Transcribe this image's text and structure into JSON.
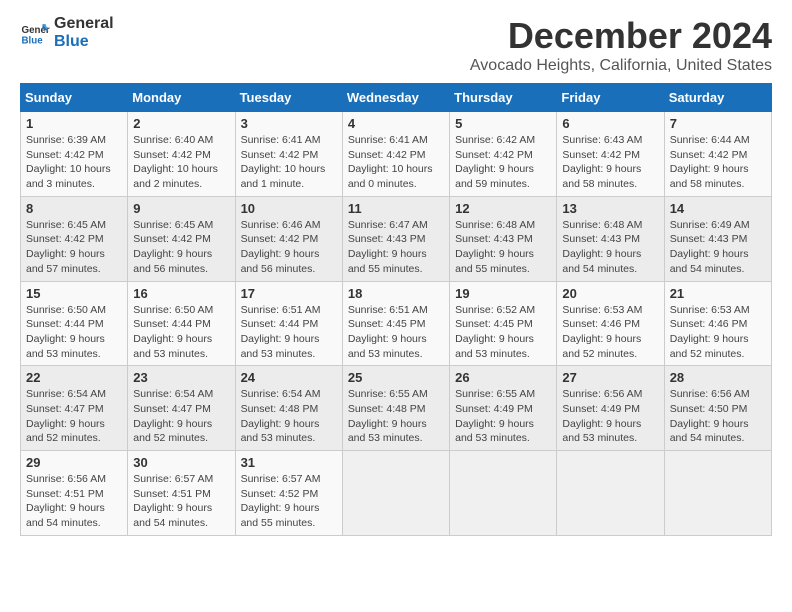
{
  "logo": {
    "line1": "General",
    "line2": "Blue"
  },
  "title": "December 2024",
  "subtitle": "Avocado Heights, California, United States",
  "headers": [
    "Sunday",
    "Monday",
    "Tuesday",
    "Wednesday",
    "Thursday",
    "Friday",
    "Saturday"
  ],
  "weeks": [
    [
      {
        "day": "1",
        "sunrise": "6:39 AM",
        "sunset": "4:42 PM",
        "daylight": "10 hours and 3 minutes."
      },
      {
        "day": "2",
        "sunrise": "6:40 AM",
        "sunset": "4:42 PM",
        "daylight": "10 hours and 2 minutes."
      },
      {
        "day": "3",
        "sunrise": "6:41 AM",
        "sunset": "4:42 PM",
        "daylight": "10 hours and 1 minute."
      },
      {
        "day": "4",
        "sunrise": "6:41 AM",
        "sunset": "4:42 PM",
        "daylight": "10 hours and 0 minutes."
      },
      {
        "day": "5",
        "sunrise": "6:42 AM",
        "sunset": "4:42 PM",
        "daylight": "9 hours and 59 minutes."
      },
      {
        "day": "6",
        "sunrise": "6:43 AM",
        "sunset": "4:42 PM",
        "daylight": "9 hours and 58 minutes."
      },
      {
        "day": "7",
        "sunrise": "6:44 AM",
        "sunset": "4:42 PM",
        "daylight": "9 hours and 58 minutes."
      }
    ],
    [
      {
        "day": "8",
        "sunrise": "6:45 AM",
        "sunset": "4:42 PM",
        "daylight": "9 hours and 57 minutes."
      },
      {
        "day": "9",
        "sunrise": "6:45 AM",
        "sunset": "4:42 PM",
        "daylight": "9 hours and 56 minutes."
      },
      {
        "day": "10",
        "sunrise": "6:46 AM",
        "sunset": "4:42 PM",
        "daylight": "9 hours and 56 minutes."
      },
      {
        "day": "11",
        "sunrise": "6:47 AM",
        "sunset": "4:43 PM",
        "daylight": "9 hours and 55 minutes."
      },
      {
        "day": "12",
        "sunrise": "6:48 AM",
        "sunset": "4:43 PM",
        "daylight": "9 hours and 55 minutes."
      },
      {
        "day": "13",
        "sunrise": "6:48 AM",
        "sunset": "4:43 PM",
        "daylight": "9 hours and 54 minutes."
      },
      {
        "day": "14",
        "sunrise": "6:49 AM",
        "sunset": "4:43 PM",
        "daylight": "9 hours and 54 minutes."
      }
    ],
    [
      {
        "day": "15",
        "sunrise": "6:50 AM",
        "sunset": "4:44 PM",
        "daylight": "9 hours and 53 minutes."
      },
      {
        "day": "16",
        "sunrise": "6:50 AM",
        "sunset": "4:44 PM",
        "daylight": "9 hours and 53 minutes."
      },
      {
        "day": "17",
        "sunrise": "6:51 AM",
        "sunset": "4:44 PM",
        "daylight": "9 hours and 53 minutes."
      },
      {
        "day": "18",
        "sunrise": "6:51 AM",
        "sunset": "4:45 PM",
        "daylight": "9 hours and 53 minutes."
      },
      {
        "day": "19",
        "sunrise": "6:52 AM",
        "sunset": "4:45 PM",
        "daylight": "9 hours and 53 minutes."
      },
      {
        "day": "20",
        "sunrise": "6:53 AM",
        "sunset": "4:46 PM",
        "daylight": "9 hours and 52 minutes."
      },
      {
        "day": "21",
        "sunrise": "6:53 AM",
        "sunset": "4:46 PM",
        "daylight": "9 hours and 52 minutes."
      }
    ],
    [
      {
        "day": "22",
        "sunrise": "6:54 AM",
        "sunset": "4:47 PM",
        "daylight": "9 hours and 52 minutes."
      },
      {
        "day": "23",
        "sunrise": "6:54 AM",
        "sunset": "4:47 PM",
        "daylight": "9 hours and 52 minutes."
      },
      {
        "day": "24",
        "sunrise": "6:54 AM",
        "sunset": "4:48 PM",
        "daylight": "9 hours and 53 minutes."
      },
      {
        "day": "25",
        "sunrise": "6:55 AM",
        "sunset": "4:48 PM",
        "daylight": "9 hours and 53 minutes."
      },
      {
        "day": "26",
        "sunrise": "6:55 AM",
        "sunset": "4:49 PM",
        "daylight": "9 hours and 53 minutes."
      },
      {
        "day": "27",
        "sunrise": "6:56 AM",
        "sunset": "4:49 PM",
        "daylight": "9 hours and 53 minutes."
      },
      {
        "day": "28",
        "sunrise": "6:56 AM",
        "sunset": "4:50 PM",
        "daylight": "9 hours and 54 minutes."
      }
    ],
    [
      {
        "day": "29",
        "sunrise": "6:56 AM",
        "sunset": "4:51 PM",
        "daylight": "9 hours and 54 minutes."
      },
      {
        "day": "30",
        "sunrise": "6:57 AM",
        "sunset": "4:51 PM",
        "daylight": "9 hours and 54 minutes."
      },
      {
        "day": "31",
        "sunrise": "6:57 AM",
        "sunset": "4:52 PM",
        "daylight": "9 hours and 55 minutes."
      },
      null,
      null,
      null,
      null
    ]
  ],
  "labels": {
    "sunrise": "Sunrise: ",
    "sunset": "Sunset: ",
    "daylight": "Daylight: "
  }
}
